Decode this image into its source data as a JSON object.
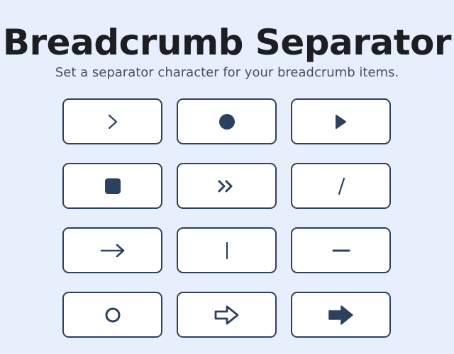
{
  "page": {
    "title": "Breadcrumb Separator",
    "subtitle": "Set a separator character for your breadcrumb items."
  },
  "colors": {
    "background": "#e8effc",
    "title": "#1c1e22",
    "subtitle": "#4a4f57",
    "button_border": "#2c4060",
    "button_fill": "#ffffff",
    "icon": "#2c4060"
  },
  "separators": [
    {
      "name": "chevron-right-icon",
      "char": "›"
    },
    {
      "name": "filled-circle-icon",
      "char": "●"
    },
    {
      "name": "play-triangle-icon",
      "char": "▶"
    },
    {
      "name": "filled-square-icon",
      "char": "■"
    },
    {
      "name": "double-chevron-right-icon",
      "char": "»"
    },
    {
      "name": "slash-icon",
      "char": "/"
    },
    {
      "name": "arrow-right-icon",
      "char": "→"
    },
    {
      "name": "vertical-bar-icon",
      "char": "|"
    },
    {
      "name": "dash-icon",
      "char": "–"
    },
    {
      "name": "hollow-circle-icon",
      "char": "○"
    },
    {
      "name": "outline-arrow-right-icon",
      "char": "⇨"
    },
    {
      "name": "bold-arrow-right-icon",
      "char": "➡"
    }
  ]
}
